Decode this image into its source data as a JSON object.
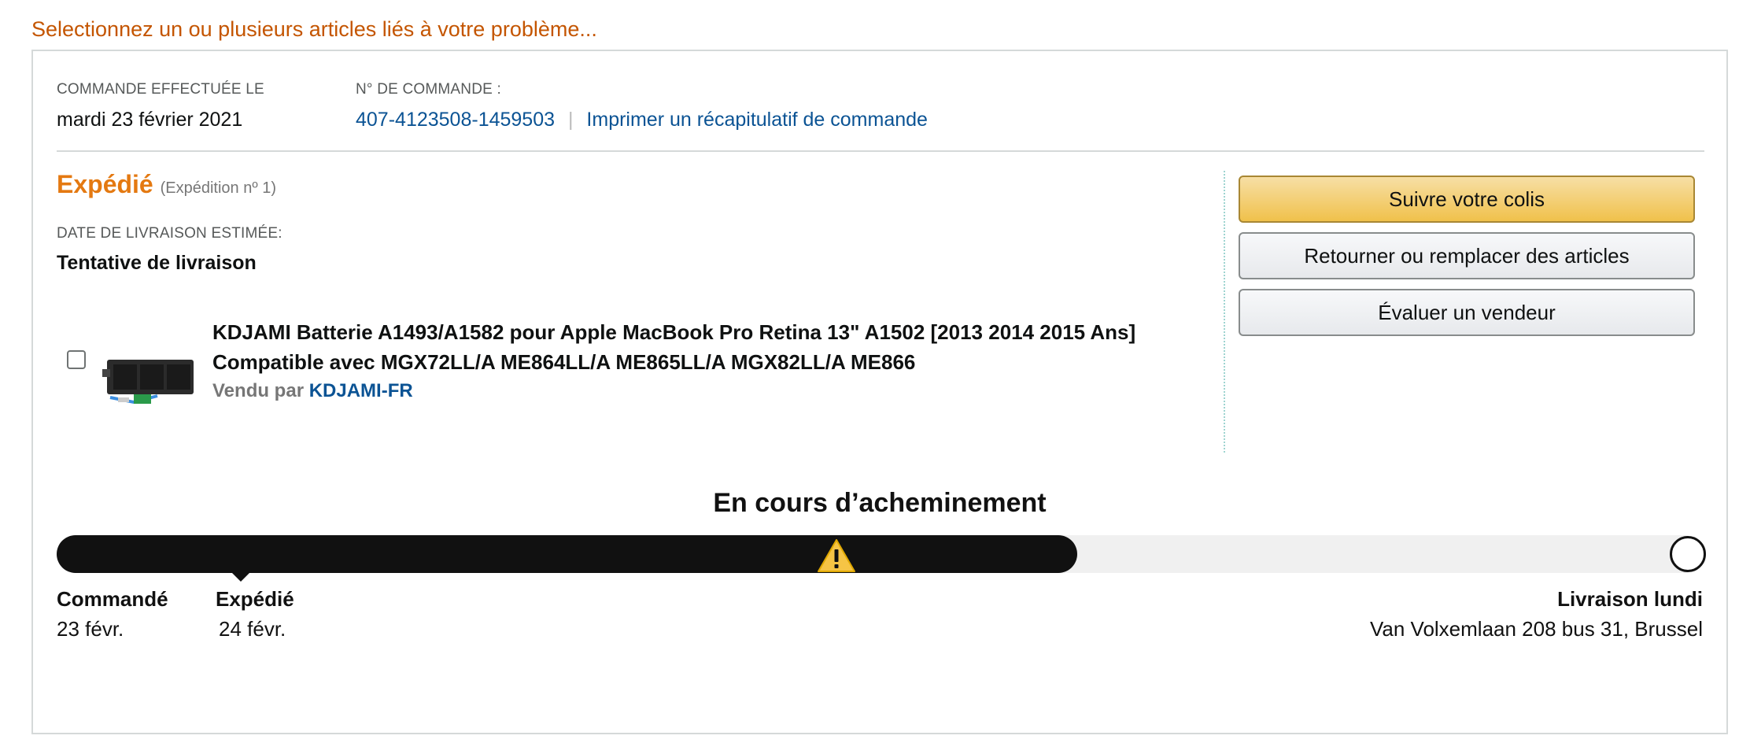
{
  "prompt": "Selectionnez un ou plusieurs articles liés à votre problème...",
  "order": {
    "placed_label": "COMMANDE EFFECTUÉE LE",
    "placed_date": "mardi 23 février 2021",
    "number_label": "N° DE COMMANDE :",
    "number": "407-4123508-1459503",
    "separator": "|",
    "print_link": "Imprimer un récapitulatif de commande"
  },
  "shipment": {
    "status": "Expédié",
    "shipment_no": "(Expédition nº 1)",
    "delivery_label": "DATE DE LIVRAISON ESTIMÉE:",
    "delivery_value": "Tentative de livraison"
  },
  "item": {
    "title": "KDJAMI Batterie A1493/A1582 pour Apple MacBook Pro Retina 13\" A1502 [2013 2014 2015 Ans] Compatible avec MGX72LL/A ME864LL/A ME865LL/A MGX82LL/A ME866",
    "sold_by_label": "Vendu par",
    "seller": "KDJAMI-FR",
    "checked": false
  },
  "actions": {
    "track": "Suivre votre colis",
    "return": "Retourner ou remplacer des articles",
    "rate": "Évaluer un vendeur"
  },
  "tracking": {
    "title": "En cours d’acheminement",
    "progress": 0.62,
    "warning_icon": "warning-triangle-icon",
    "stages": [
      {
        "label": "Commandé",
        "date": "23 févr."
      },
      {
        "label": "Expédié",
        "date": "24 févr."
      }
    ],
    "final_label": "Livraison lundi",
    "address": "Van Volxemlaan 208 bus 31, Brussel"
  },
  "colors": {
    "accent_orange": "#e47911",
    "link_blue": "#0b5394",
    "primary_button": "#f0c14b",
    "progress_fill": "#111111",
    "warning_yellow": "#f6c445"
  }
}
